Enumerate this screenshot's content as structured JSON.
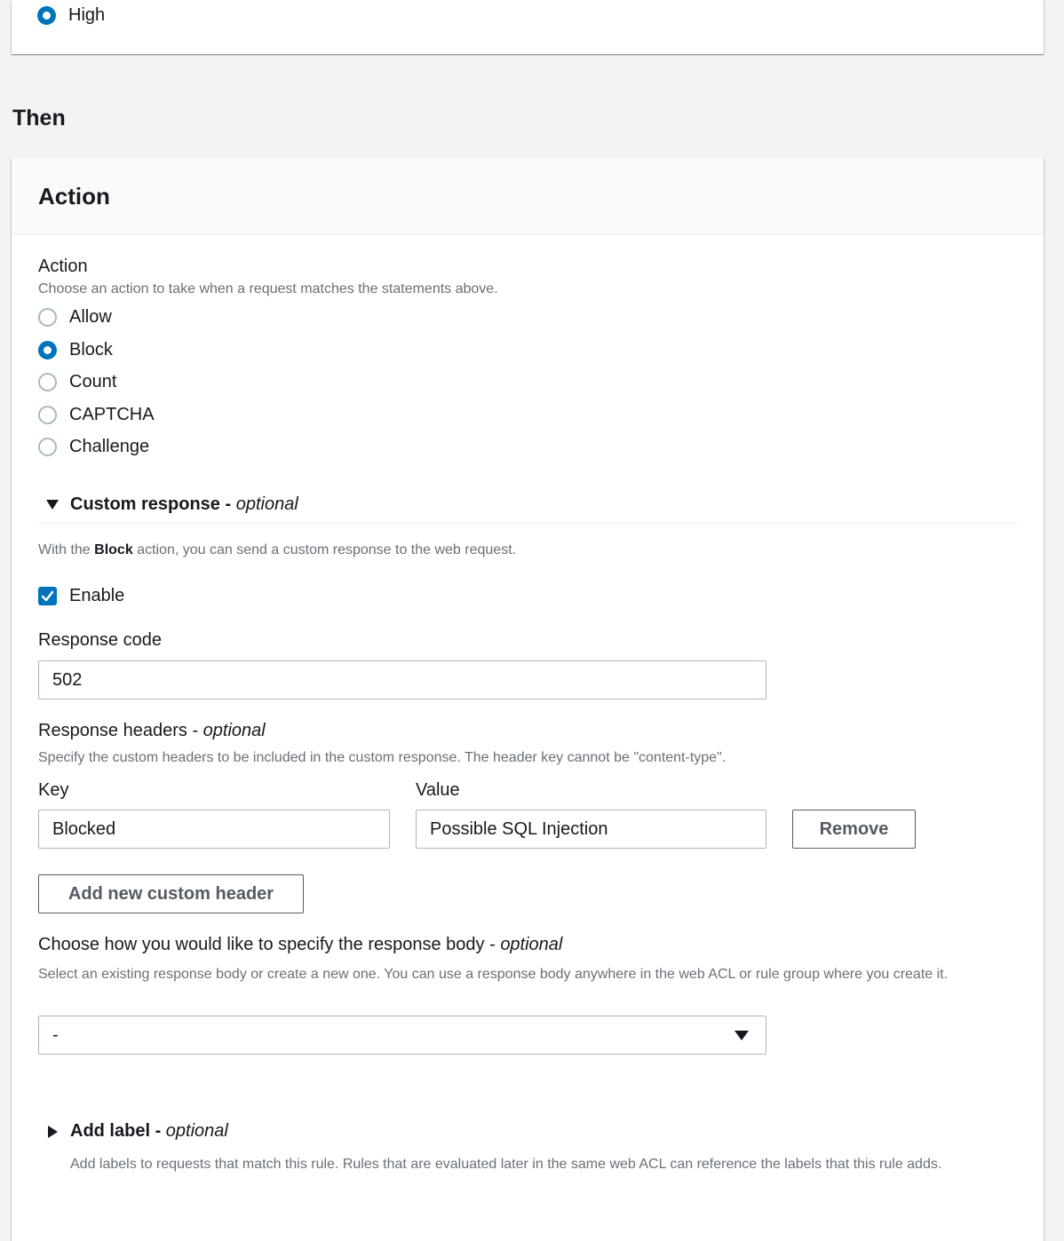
{
  "sensitivity": {
    "selected_label": "High"
  },
  "then_section": {
    "title": "Then"
  },
  "action_panel": {
    "header": "Action",
    "field_label": "Action",
    "field_description": "Choose an action to take when a request matches the statements above.",
    "options": [
      {
        "label": "Allow",
        "selected": false
      },
      {
        "label": "Block",
        "selected": true
      },
      {
        "label": "Count",
        "selected": false
      },
      {
        "label": "CAPTCHA",
        "selected": false
      },
      {
        "label": "Challenge",
        "selected": false
      }
    ]
  },
  "custom_response": {
    "title": "Custom response",
    "title_suffix": "optional",
    "title_sep": " - ",
    "expanded": true,
    "intro_before": "With the ",
    "intro_bold": "Block",
    "intro_after": " action, you can send a custom response to the web request.",
    "enable_label": "Enable",
    "enable_checked": true,
    "response_code_label": "Response code",
    "response_code_value": "502",
    "headers_label": "Response headers",
    "headers_label_suffix": "optional",
    "headers_description": "Specify the custom headers to be included in the custom response. The header key cannot be \"content-type\".",
    "key_label": "Key",
    "value_label": "Value",
    "headers": [
      {
        "key": "Blocked",
        "value": "Possible SQL Injection"
      }
    ],
    "remove_button": "Remove",
    "add_header_button": "Add new custom header",
    "body_label": "Choose how you would like to specify the response body",
    "body_label_suffix": "optional",
    "body_description": "Select an existing response body or create a new one. You can use a response body anywhere in the web ACL or rule group where you create it.",
    "body_select_value": "-"
  },
  "add_label": {
    "title": "Add label",
    "title_suffix": "optional",
    "title_sep": " - ",
    "expanded": false,
    "description": "Add labels to requests that match this rule. Rules that are evaluated later in the same web ACL can reference the labels that this rule adds."
  },
  "colors": {
    "accent": "#0073bb",
    "page_bg": "#f2f3f3",
    "text": "#16191f",
    "muted_text": "#687078",
    "border": "#aab7b8"
  }
}
